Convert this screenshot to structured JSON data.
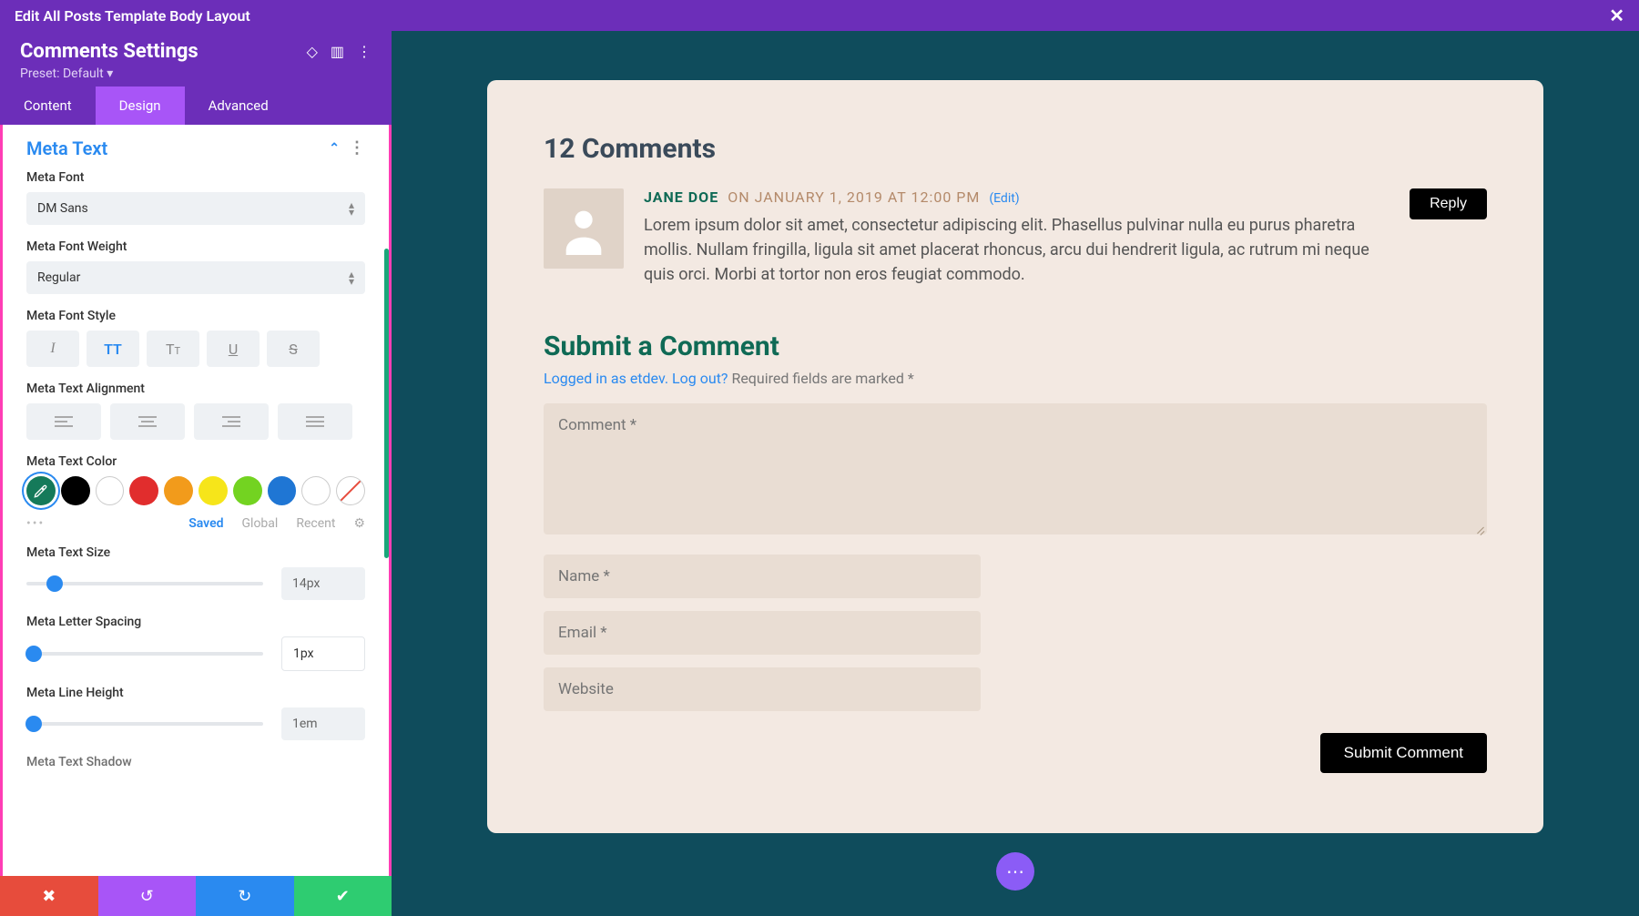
{
  "header": {
    "title": "Edit All Posts Template Body Layout",
    "close": "✕"
  },
  "sidebar": {
    "title": "Comments Settings",
    "preset_label": "Preset: Default",
    "tabs": {
      "content": "Content",
      "design": "Design",
      "advanced": "Advanced"
    },
    "section_title": "Meta Text",
    "labels": {
      "font": "Meta Font",
      "weight": "Meta Font Weight",
      "style": "Meta Font Style",
      "alignment": "Meta Text Alignment",
      "color": "Meta Text Color",
      "size": "Meta Text Size",
      "spacing": "Meta Letter Spacing",
      "lineheight": "Meta Line Height",
      "shadow": "Meta Text Shadow"
    },
    "values": {
      "font": "DM Sans",
      "weight": "Regular",
      "size": "14px",
      "spacing": "1px",
      "lineheight": "1em"
    },
    "color_tabs": {
      "saved": "Saved",
      "global": "Global",
      "recent": "Recent"
    },
    "colors": [
      "#157a5a",
      "#000000",
      "#ffffff",
      "#e12d2d",
      "#f29b1b",
      "#f6e51a",
      "#73d321",
      "#1f76d4",
      "#ffffff",
      "none"
    ]
  },
  "preview": {
    "comments_heading": "12 Comments",
    "comment": {
      "author": "JANE DOE",
      "date": "ON JANUARY 1, 2019 AT 12:00 PM",
      "edit": "(Edit)",
      "body": "Lorem ipsum dolor sit amet, consectetur adipiscing elit. Phasellus pulvinar nulla eu purus pharetra mollis. Nullam fringilla, ligula sit amet placerat rhoncus, arcu dui hendrerit ligula, ac rutrum mi neque quis orci. Morbi at tortor non eros feugiat commodo.",
      "reply": "Reply"
    },
    "submit_heading": "Submit a Comment",
    "logged_in": "Logged in as etdev.",
    "logout": "Log out?",
    "required": "Required fields are marked *",
    "placeholders": {
      "comment": "Comment *",
      "name": "Name *",
      "email": "Email *",
      "website": "Website"
    },
    "submit_button": "Submit Comment"
  }
}
